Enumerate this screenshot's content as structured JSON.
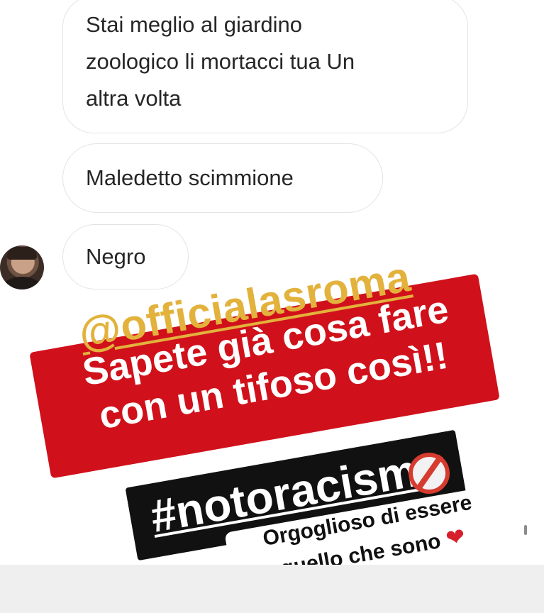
{
  "messages": [
    {
      "lines": [
        "Stai meglio al giardino",
        "zoologico li mortacci tua Un",
        "altra volta"
      ]
    },
    {
      "text": "Maledetto scimmione"
    },
    {
      "text": "Negro"
    }
  ],
  "overlay": {
    "mention": "@officialasroma",
    "headline_line1": "Sapete già cosa fare",
    "headline_line2": "con un tifoso così!!",
    "hashtag": "#notoracism",
    "caption_line1": "Orgoglioso di essere",
    "caption_line2": "quello che sono",
    "heart": "❤",
    "no_icon": "prohibited-icon"
  },
  "colors": {
    "red": "#d0111b",
    "gold": "#e3b23c",
    "bubble_border": "#e3e3e3"
  }
}
